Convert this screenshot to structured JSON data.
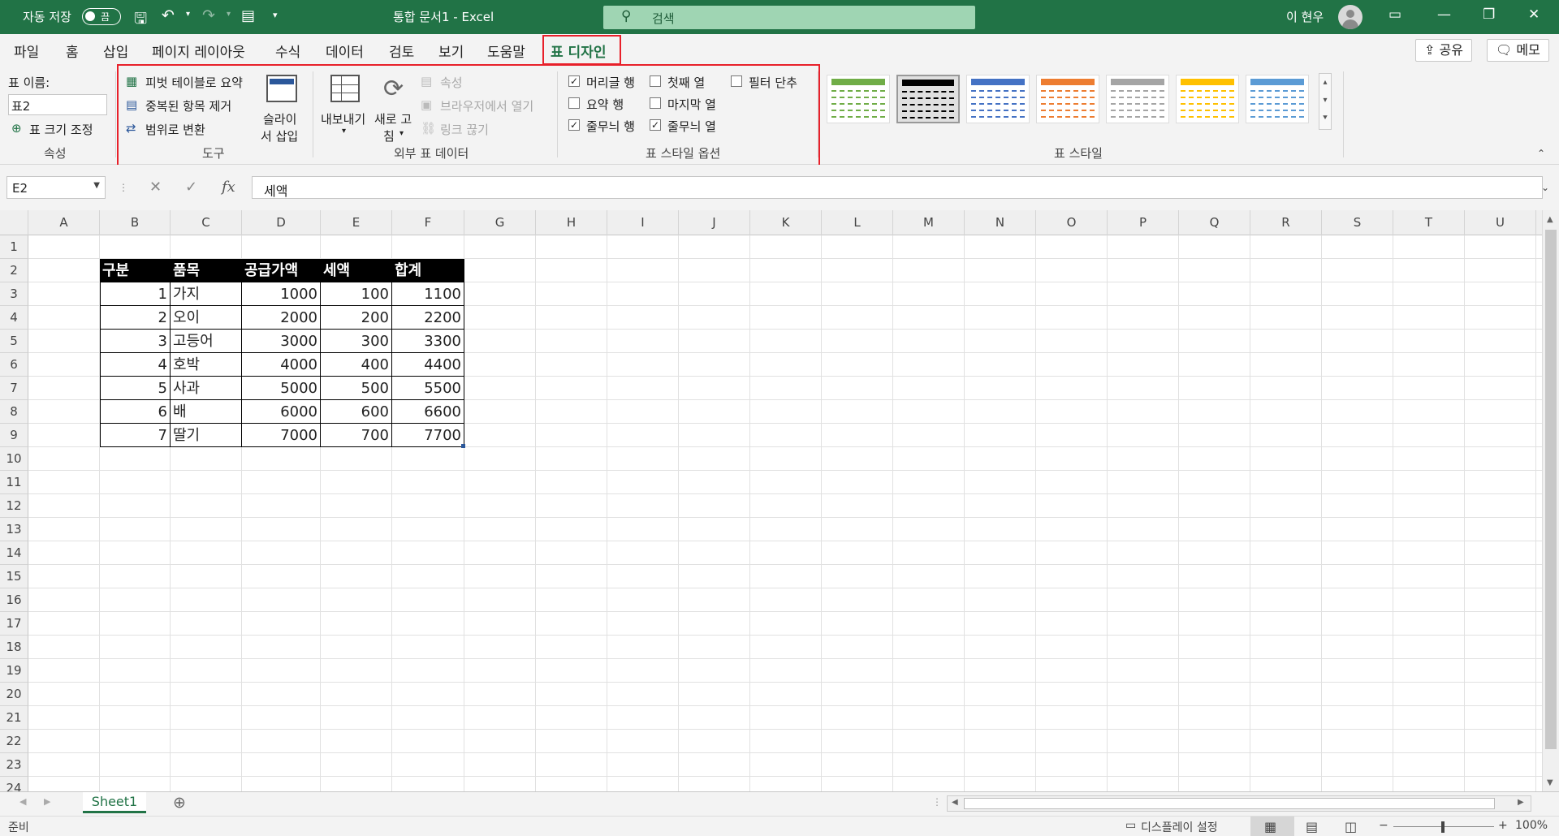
{
  "window": {
    "autosave_label": "자동 저장",
    "autosave_state": "끔",
    "doc_title": "통합 문서1 - Excel",
    "search_placeholder": "검색",
    "user_name": "이 현우"
  },
  "tabs": [
    "파일",
    "홈",
    "삽입",
    "페이지 레이아웃",
    "수식",
    "데이터",
    "검토",
    "보기",
    "도움말",
    "표 디자인"
  ],
  "active_tab": "표 디자인",
  "share_label": "공유",
  "comment_label": "메모",
  "ribbon": {
    "properties": {
      "table_name_label": "표 이름:",
      "table_name_value": "표2",
      "resize_label": "표 크기 조정",
      "group_label": "속성"
    },
    "tools": {
      "pivot_label": "피벗 테이블로 요약",
      "remove_dup_label": "중복된 항목 제거",
      "convert_label": "범위로 변환",
      "slicer_label_1": "슬라이",
      "slicer_label_2": "서 삽입",
      "group_label": "도구"
    },
    "external": {
      "export_label": "내보내기",
      "refresh_label_1": "새로 고",
      "refresh_label_2": "침",
      "properties_label": "속성",
      "browser_label": "브라우저에서 열기",
      "unlink_label": "링크 끊기",
      "group_label": "외부 표 데이터"
    },
    "style_options": {
      "header_row": {
        "label": "머리글 행",
        "checked": true
      },
      "total_row": {
        "label": "요약 행",
        "checked": false
      },
      "banded_rows": {
        "label": "줄무늬 행",
        "checked": true
      },
      "first_column": {
        "label": "첫째 열",
        "checked": false
      },
      "last_column": {
        "label": "마지막 열",
        "checked": false
      },
      "banded_columns": {
        "label": "줄무늬 열",
        "checked": true
      },
      "filter_button": {
        "label": "필터 단추",
        "checked": false
      },
      "group_label": "표 스타일 옵션"
    },
    "table_styles": {
      "group_label": "표 스타일",
      "swatch_colors": [
        "#70ad47",
        "#000000",
        "#4472c4",
        "#ed7d31",
        "#a5a5a5",
        "#ffc000",
        "#5b9bd5"
      ]
    }
  },
  "formula_bar": {
    "name_box": "E2",
    "formula": "세액",
    "fx_label": "fx"
  },
  "columns": [
    "A",
    "B",
    "C",
    "D",
    "E",
    "F",
    "G",
    "H",
    "I",
    "J",
    "K",
    "L",
    "M",
    "N",
    "O",
    "P",
    "Q",
    "R",
    "S",
    "T",
    "U"
  ],
  "rows": [
    "1",
    "2",
    "3",
    "4",
    "5",
    "6",
    "7",
    "8",
    "9",
    "10",
    "11",
    "12",
    "13",
    "14",
    "15",
    "16",
    "17",
    "18",
    "19",
    "20",
    "21",
    "22",
    "23",
    "24"
  ],
  "table": {
    "headers": [
      "구분",
      "품목",
      "공급가액",
      "세액",
      "합계"
    ],
    "rows": [
      [
        "1",
        "가지",
        "1000",
        "100",
        "1100"
      ],
      [
        "2",
        "오이",
        "2000",
        "200",
        "2200"
      ],
      [
        "3",
        "고등어",
        "3000",
        "300",
        "3300"
      ],
      [
        "4",
        "호박",
        "4000",
        "400",
        "4400"
      ],
      [
        "5",
        "사과",
        "5000",
        "500",
        "5500"
      ],
      [
        "6",
        "배",
        "6000",
        "600",
        "6600"
      ],
      [
        "7",
        "딸기",
        "7000",
        "700",
        "7700"
      ]
    ]
  },
  "sheet_tab": "Sheet1",
  "status": {
    "ready": "준비",
    "display_settings": "디스플레이 설정",
    "zoom": "100%"
  },
  "colors": {
    "accent": "#217346",
    "highlight": "#e8202a"
  }
}
